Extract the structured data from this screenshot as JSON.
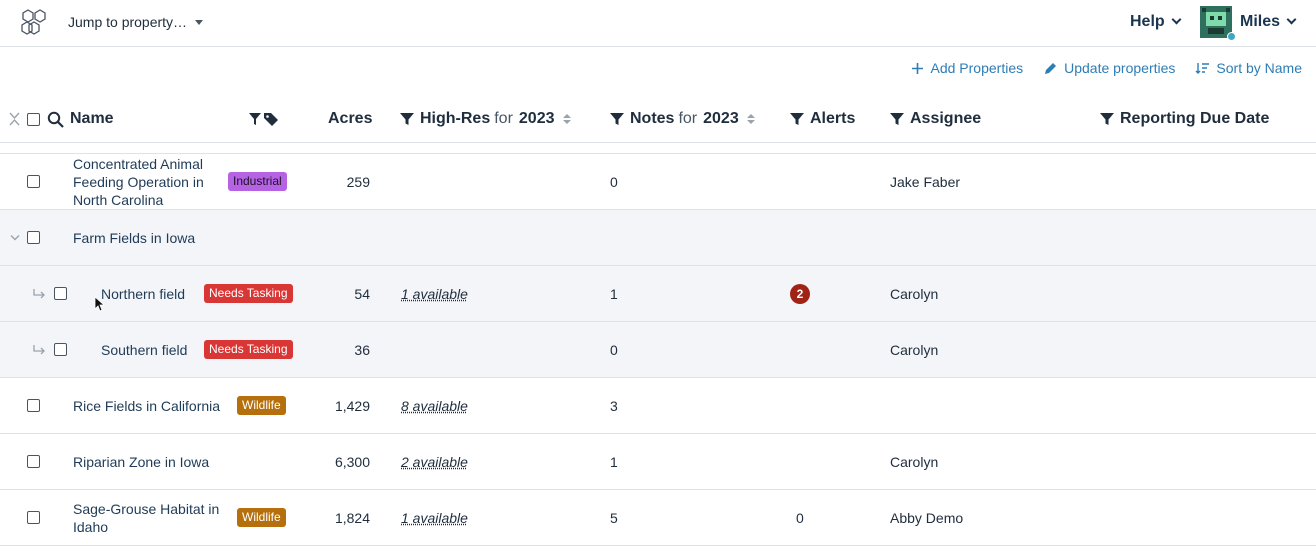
{
  "topbar": {
    "jump_label": "Jump to property…",
    "help_label": "Help",
    "user_name": "Miles"
  },
  "actions": {
    "add": "Add Properties",
    "update": "Update properties",
    "sort": "Sort by Name"
  },
  "columns": {
    "name": "Name",
    "acres": "Acres",
    "highres": "High-Res",
    "highres_for": "for",
    "highres_year": "2023",
    "notes": "Notes",
    "notes_for": "for",
    "notes_year": "2023",
    "alerts": "Alerts",
    "assignee": "Assignee",
    "due": "Reporting Due Date"
  },
  "rows": [
    {
      "name": "Concentrated Animal Feeding Operation in North Carolina",
      "tag": "Industrial",
      "acres": "259",
      "highres": "",
      "notes": "0",
      "alerts": "",
      "assignee": "Jake Faber"
    },
    {
      "name": "Farm Fields in Iowa",
      "tag": "",
      "acres": "",
      "highres": "",
      "notes": "",
      "alerts": "",
      "assignee": ""
    },
    {
      "name": "Northern field",
      "tag": "Needs Tasking",
      "acres": "54",
      "highres": "1 available",
      "notes": "1",
      "alerts": "2",
      "assignee": "Carolyn"
    },
    {
      "name": "Southern field",
      "tag": "Needs Tasking",
      "acres": "36",
      "highres": "",
      "notes": "0",
      "alerts": "",
      "assignee": "Carolyn"
    },
    {
      "name": "Rice Fields in California",
      "tag": "Wildlife",
      "acres": "1,429",
      "highres": "8 available",
      "notes": "3",
      "alerts": "",
      "assignee": ""
    },
    {
      "name": "Riparian Zone in Iowa",
      "tag": "",
      "acres": "6,300",
      "highres": "2 available",
      "notes": "1",
      "alerts": "",
      "assignee": "Carolyn"
    },
    {
      "name": "Sage-Grouse Habitat in Idaho",
      "tag": "Wildlife",
      "acres": "1,824",
      "highres": "1 available",
      "notes": "5",
      "alerts": "0",
      "assignee": "Abby Demo"
    }
  ],
  "colors": {
    "industrial_bg": "#b563e3",
    "needs_tasking_bg": "#d93636",
    "wildlife_bg": "#b5700d",
    "alert_bg": "#a02316",
    "link": "#2e7db5"
  }
}
